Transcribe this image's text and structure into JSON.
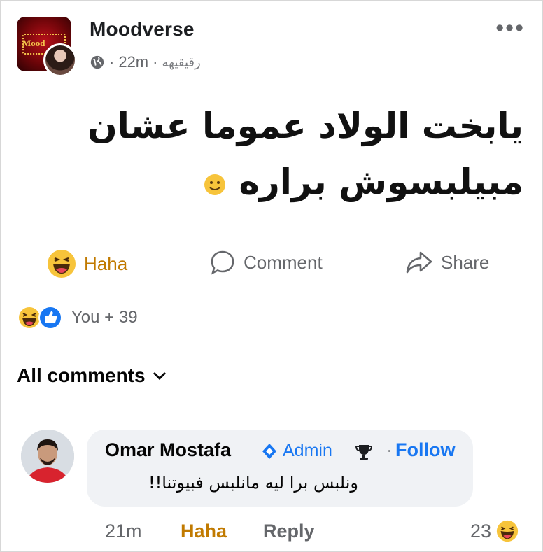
{
  "post": {
    "page_name": "Moodverse",
    "time": "22m",
    "separator": "·",
    "author_sig": "رقيقيهه",
    "text_line1": "يابخت الولاد عموما عشان",
    "text_line2": "مبيلبسوش براره",
    "logo_text": "Mood"
  },
  "actions": {
    "haha": "Haha",
    "comment": "Comment",
    "share": "Share"
  },
  "reactions": {
    "summary": "You + 39"
  },
  "comments_header": {
    "label": "All comments"
  },
  "comment": {
    "author": "Omar Mostafa",
    "badge": "Admin",
    "follow": "Follow",
    "follow_dot": "·",
    "text": "ونلبس برا ليه مانلبس فبيوتنا!!",
    "time": "21m",
    "haha": "Haha",
    "reply": "Reply",
    "reaction_count": "23"
  },
  "colors": {
    "brand_blue": "#1877f2",
    "haha_gold": "#c17a00",
    "muted": "#65676b"
  }
}
